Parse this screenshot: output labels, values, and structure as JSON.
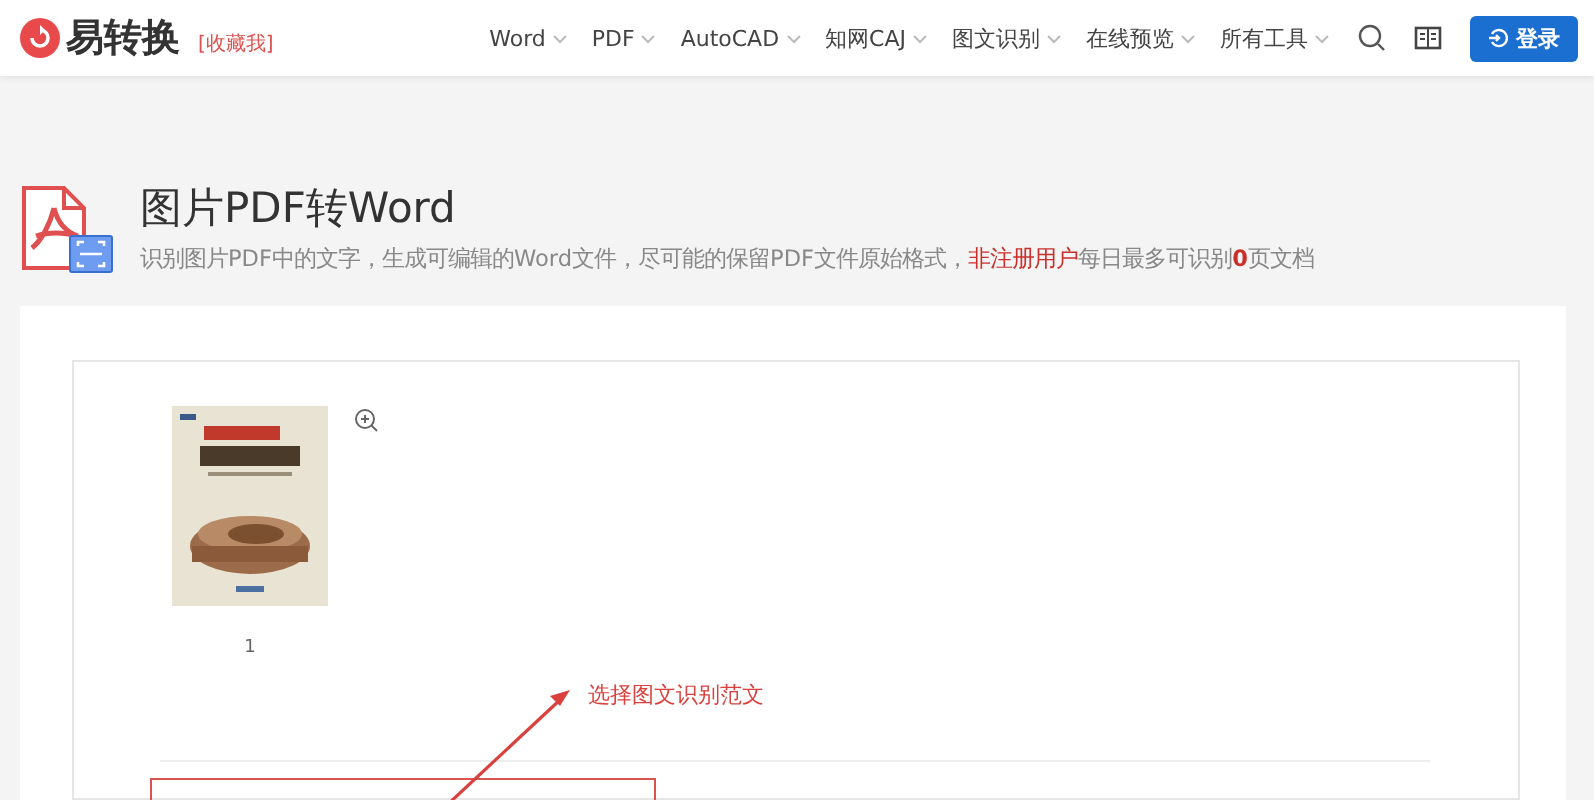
{
  "header": {
    "logo_text": "易转换",
    "bookmark_link": "[收藏我]",
    "nav": [
      {
        "label": "Word"
      },
      {
        "label": "PDF"
      },
      {
        "label": "AutoCAD"
      },
      {
        "label": "知网CAJ"
      },
      {
        "label": "图文识别"
      },
      {
        "label": "在线预览"
      },
      {
        "label": "所有工具"
      }
    ],
    "login_button": "登录"
  },
  "page_header": {
    "title": "图片PDF转Word",
    "description": [
      {
        "kind": "plain",
        "text": "识别图片PDF中的文字，生成可编辑的Word文件，尽可能的保留PDF文件原始格式，"
      },
      {
        "kind": "highlight",
        "text": "非注册用户"
      },
      {
        "kind": "plain",
        "text": "每日最多可识别"
      },
      {
        "kind": "count",
        "text": "0"
      },
      {
        "kind": "plain",
        "text": "页文档"
      }
    ]
  },
  "pages": [
    {
      "kind": "picture",
      "page_number": "1"
    }
  ],
  "annotation": {
    "text": "选择图文识别范文"
  }
}
